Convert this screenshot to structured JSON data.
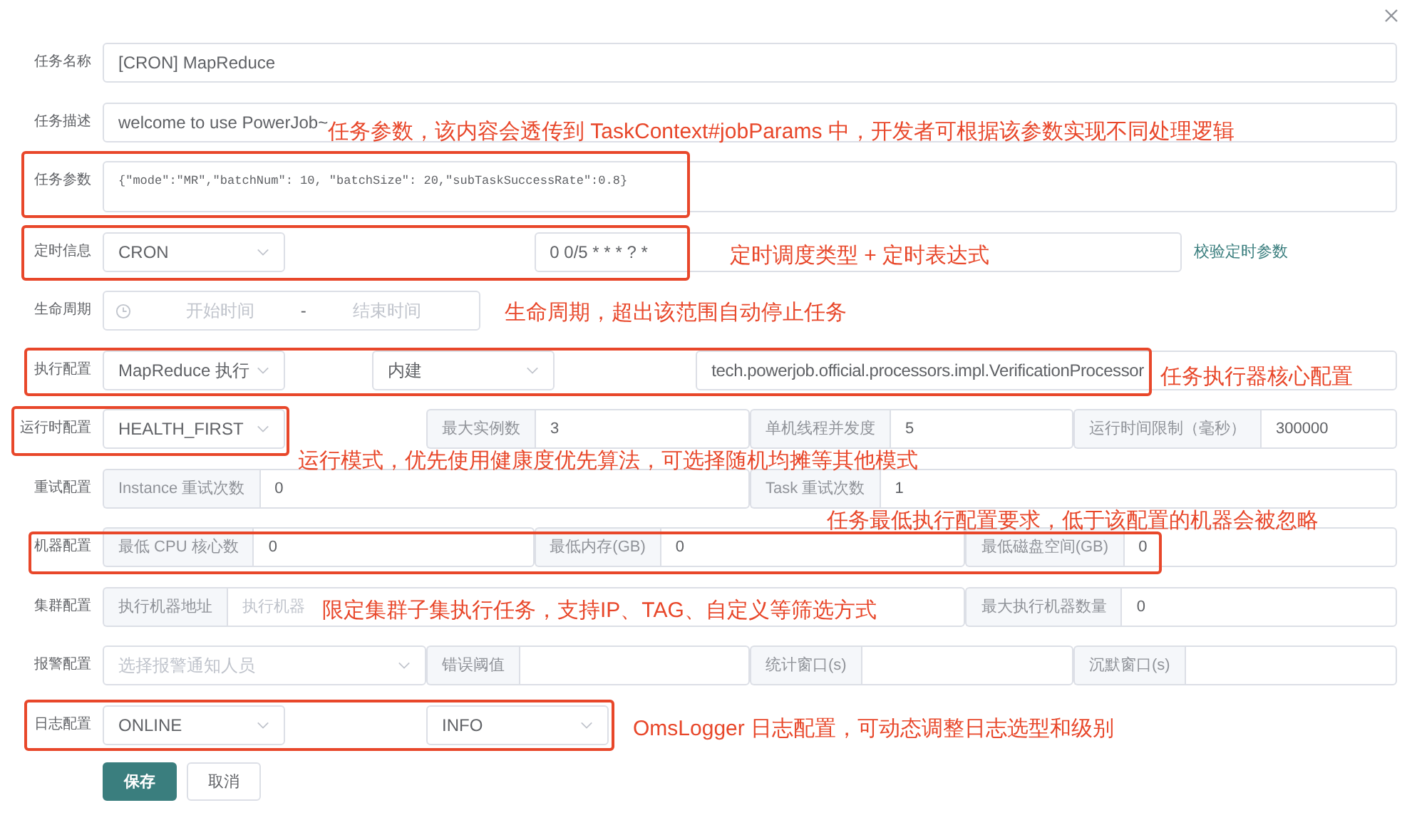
{
  "name": {
    "label": "任务名称",
    "value": "[CRON] MapReduce"
  },
  "description": {
    "label": "任务描述",
    "value": "welcome to use PowerJob~"
  },
  "params": {
    "label": "任务参数",
    "value": "{\"mode\":\"MR\",\"batchNum\": 10, \"batchSize\": 20,\"subTaskSuccessRate\":0.8}"
  },
  "timing": {
    "label": "定时信息",
    "type": "CRON",
    "expression": "0 0/5 * * * ? *",
    "validate_link": "校验定时参数"
  },
  "lifecycle": {
    "label": "生命周期",
    "start_placeholder": "开始时间",
    "separator": "-",
    "end_placeholder": "结束时间"
  },
  "execution": {
    "label": "执行配置",
    "type": "MapReduce 执行",
    "processor_type": "内建",
    "processor": "tech.powerjob.official.processors.impl.VerificationProcessor"
  },
  "runtime": {
    "label": "运行时配置",
    "dispatch": "HEALTH_FIRST",
    "groups": [
      {
        "label": "最大实例数",
        "value": "3"
      },
      {
        "label": "单机线程并发度",
        "value": "5"
      },
      {
        "label": "运行时间限制（毫秒）",
        "value": "300000"
      }
    ]
  },
  "retry": {
    "label": "重试配置",
    "groups": [
      {
        "label": "Instance 重试次数",
        "value": "0"
      },
      {
        "label": "Task 重试次数",
        "value": "1"
      }
    ]
  },
  "machine": {
    "label": "机器配置",
    "groups": [
      {
        "label": "最低 CPU 核心数",
        "value": "0"
      },
      {
        "label": "最低内存(GB)",
        "value": "0"
      },
      {
        "label": "最低磁盘空间(GB)",
        "value": "0"
      }
    ]
  },
  "cluster": {
    "label": "集群配置",
    "groups": [
      {
        "label": "执行机器地址",
        "placeholder": "执行机器"
      },
      {
        "label": "最大执行机器数量",
        "value": "0"
      }
    ]
  },
  "alarm": {
    "label": "报警配置",
    "placeholder": "选择报警通知人员",
    "groups": [
      {
        "label": "错误阈值"
      },
      {
        "label": "统计窗口(s)"
      },
      {
        "label": "沉默窗口(s)"
      }
    ]
  },
  "log": {
    "label": "日志配置",
    "type": "ONLINE",
    "level": "INFO"
  },
  "buttons": {
    "save": "保存",
    "cancel": "取消"
  },
  "annotations": [
    "任务参数，该内容会透传到 TaskContext#jobParams 中，开发者可根据该参数实现不同处理逻辑",
    "定时调度类型 + 定时表达式",
    "生命周期，超出该范围自动停止任务",
    "任务执行器核心配置",
    "运行模式，优先使用健康度优先算法，可选择随机均摊等其他模式",
    "任务最低执行配置要求，低于该配置的机器会被忽略",
    "限定集群子集执行任务，支持IP、TAG、自定义等筛选方式",
    "OmsLogger 日志配置，可动态调整日志选型和级别"
  ]
}
